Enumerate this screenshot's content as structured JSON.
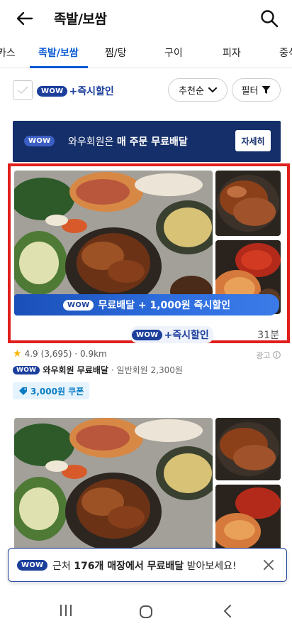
{
  "header": {
    "title": "족발/보쌈"
  },
  "tabs": [
    {
      "label": "카스"
    },
    {
      "label": "족발/보쌈"
    },
    {
      "label": "찜/탕"
    },
    {
      "label": "구이"
    },
    {
      "label": "피자"
    },
    {
      "label": "중식"
    }
  ],
  "filters": {
    "wow_badge": "WOW",
    "wow_label": "+즉시할인",
    "sort_label": "추천순",
    "filter_label": "필터"
  },
  "banner": {
    "badge": "WOW",
    "text_prefix": "와우회원은 ",
    "text_bold": "매 주문 무료배달",
    "button": "자세히"
  },
  "card1": {
    "promo_badge": "WOW",
    "promo_text": "무료배달 + 1,000원 즉시할인",
    "wow_badge": "WOW",
    "wow_label": "+즉시할인",
    "time": "31분",
    "rating": "4.9",
    "reviews": "(3,695)",
    "distance": "· 0.9km",
    "ad_label": "광고",
    "delivery_badge": "WOW",
    "delivery_bold": "와우회원 무료배달",
    "delivery_sub": "· 일반회원 2,300원",
    "coupon": "3,000원 쿠폰"
  },
  "toast": {
    "badge": "WOW",
    "text_prefix": "근처 ",
    "text_bold": "176개 매장에서 무료배달",
    "text_suffix": " 받아보세요!"
  },
  "colors": {
    "accent": "#0a5ad4",
    "wow_navy": "#1c3f9c",
    "banner_bg": "#152f6b",
    "highlight_red": "#e0201d",
    "coupon_blue": "#0a7cc4"
  }
}
